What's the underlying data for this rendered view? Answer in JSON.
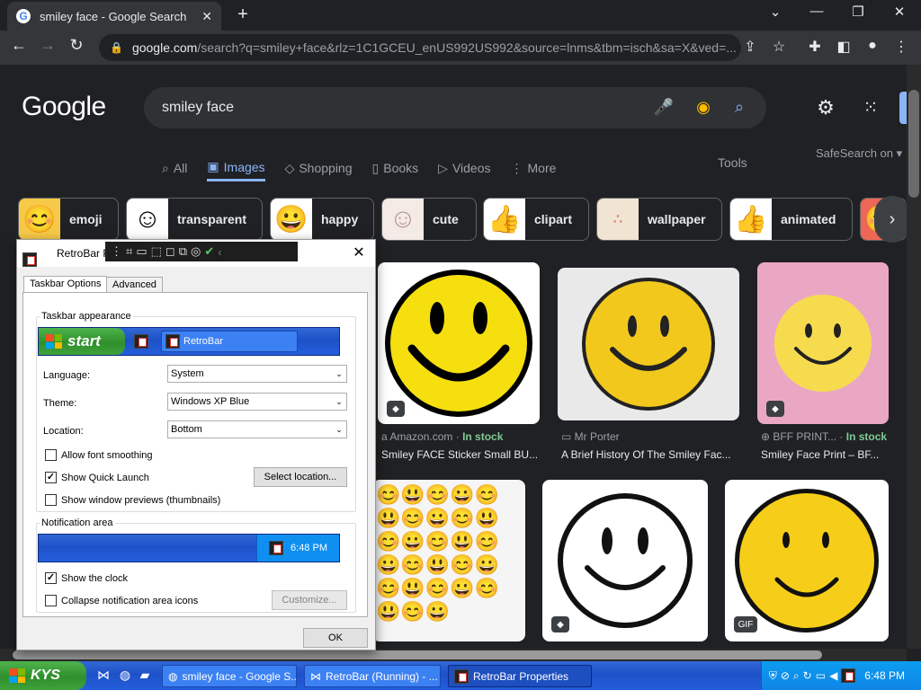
{
  "browser": {
    "tab_title": "smiley face - Google Search",
    "tab_favicon": "G",
    "url_host": "google.com",
    "url_path": "/search?q=smiley+face&rlz=1C1GCEU_enUS992US992&source=lnms&tbm=isch&sa=X&ved=..."
  },
  "google": {
    "logo": "Google",
    "query": "smiley face",
    "tabs": [
      "All",
      "Images",
      "Shopping",
      "Books",
      "Videos",
      "More"
    ],
    "tools": "Tools",
    "safesearch": "SafeSearch on",
    "chips": [
      "emoji",
      "transparent",
      "happy",
      "cute",
      "clipart",
      "wallpaper",
      "animated"
    ],
    "results": [
      {
        "source": "Amazon.com",
        "stock": "In stock",
        "caption": "Smiley FACE Sticker Small BU..."
      },
      {
        "source": "Mr Porter",
        "stock": "",
        "caption": "A Brief History Of The Smiley Fac..."
      },
      {
        "source": "BFF PRINT...",
        "stock": "In stock",
        "caption": "Smiley Face Print – BF..."
      }
    ],
    "gif_badge": "GIF"
  },
  "dialog": {
    "title": "RetroBar P",
    "tabs": [
      "Taskbar Options",
      "Advanced"
    ],
    "appearance_group": "Taskbar appearance",
    "preview_start": "start",
    "preview_task": "RetroBar",
    "language_label": "Language:",
    "language_value": "System",
    "theme_label": "Theme:",
    "theme_value": "Windows XP Blue",
    "location_label": "Location:",
    "location_value": "Bottom",
    "opt_font_smoothing": "Allow font smoothing",
    "opt_quick_launch": "Show Quick Launch",
    "select_location": "Select location...",
    "opt_previews": "Show window previews (thumbnails)",
    "notification_group": "Notification area",
    "preview_clock": "6:48 PM",
    "opt_clock": "Show the clock",
    "opt_collapse": "Collapse notification area icons",
    "customize": "Customize...",
    "ok": "OK"
  },
  "taskbar": {
    "start": "KYS",
    "tasks": [
      "smiley face - Google S...",
      "RetroBar (Running) - ...",
      "RetroBar Properties"
    ],
    "clock": "6:48 PM"
  },
  "colors": {
    "accent": "#8ab4f8",
    "in_stock": "#81c995",
    "xp_blue": "#245edc",
    "xp_green": "#3ea23a"
  }
}
